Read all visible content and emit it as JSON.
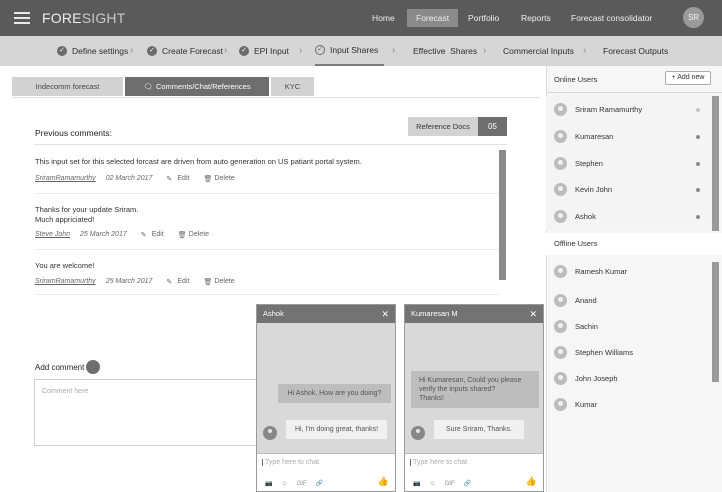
{
  "app": {
    "logo_main": "FORE",
    "logo_rest": "SIGHT",
    "user_initials": "SR"
  },
  "nav": {
    "home": "Home",
    "forecast": "Forecast",
    "portfolio": "Portfolio",
    "reports": "Reports",
    "consolidator": "Forecast consolidator"
  },
  "steps": [
    {
      "label": "Define settings",
      "state": "done"
    },
    {
      "label": "Create Forecast",
      "state": "done"
    },
    {
      "label": "EPI Input",
      "state": "done"
    },
    {
      "label": "Input Shares",
      "state": "current"
    },
    {
      "label": "Effective  Shares",
      "state": "pending"
    },
    {
      "label": "Commercial Inputs",
      "state": "pending"
    },
    {
      "label": "Forecast Outputs",
      "state": "pending"
    }
  ],
  "tabs": {
    "indecomm": "Indecomm forecast",
    "comments": "Comments/Chat/References",
    "kyc": "KYC"
  },
  "comments_section": {
    "title": "Previous comments:",
    "ref_docs_label": "Reference Docs",
    "ref_docs_count": "05",
    "edit_label": "Edit",
    "delete_label": "Delete",
    "items": [
      {
        "text": "This input set for this selected forcast are driven from auto generation on US patiant portal system.",
        "author": "SriramRamamurthy",
        "date": "02 March 2017"
      },
      {
        "text_line1": "Thanks for your update Sriram.",
        "text_line2": "Much appriciated!",
        "author": "Steve John",
        "date": "25 March 2017"
      },
      {
        "text": "You are welcome!",
        "author": "SriramRamamurthy",
        "date": "25 March 2017"
      }
    ],
    "add_comment_label": "Add comment",
    "comment_placeholder": "Comment here"
  },
  "right_panel": {
    "online_title": "Online Users",
    "add_new_label": "+ Add new",
    "online_users": [
      "Sriram Ramamurthy",
      "Kumaresan",
      "Stephen",
      "Kevin John",
      "Ashok"
    ],
    "offline_title": "Offline Users",
    "offline_users": [
      "Ramesh Kumar",
      "Anand",
      "Sachin",
      "Stephen Williams",
      "John Joseph",
      "Kumar"
    ]
  },
  "chats": [
    {
      "name": "Ashok",
      "sent": "Hi Ashok, How are you doing?",
      "received": "Hi, I'm doing great, thanks!",
      "placeholder": "Type here to chat"
    },
    {
      "name": "Kumaresan M",
      "sent_line1": "Hi Kumaresan, Could you please",
      "sent_line2": "verify the inputs shared?",
      "sent_line3": "Thanks!",
      "received": "Sure Sriram, Thanks.",
      "placeholder": "Type here to chat"
    }
  ],
  "chat_tools": {
    "gif": "GIF"
  }
}
